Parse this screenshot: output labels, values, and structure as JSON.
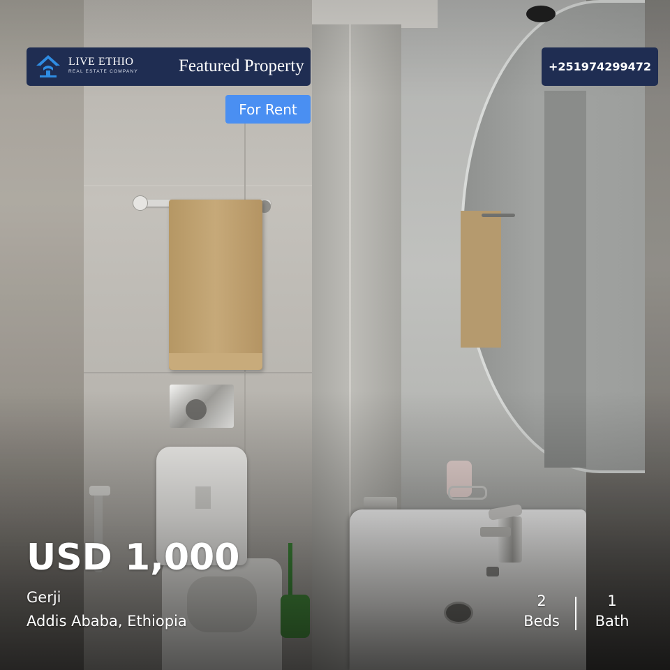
{
  "brand": {
    "name": "LIVE ETHIO",
    "tagline": "REAL ESTATE COMPANY"
  },
  "header": {
    "title": "Featured Property"
  },
  "contact": {
    "phone": "+251974299472"
  },
  "listing": {
    "status": "For Rent",
    "price": "USD 1,000",
    "area": "Gerji",
    "city": "Addis Ababa, Ethiopia",
    "beds_count": "2",
    "beds_label": "Beds",
    "bath_count": "1",
    "bath_label": "Bath"
  },
  "colors": {
    "navy": "#1f2d52",
    "badge_blue": "#4a8ff2",
    "text": "#ffffff"
  },
  "icons": {
    "logo": "house-icon"
  }
}
